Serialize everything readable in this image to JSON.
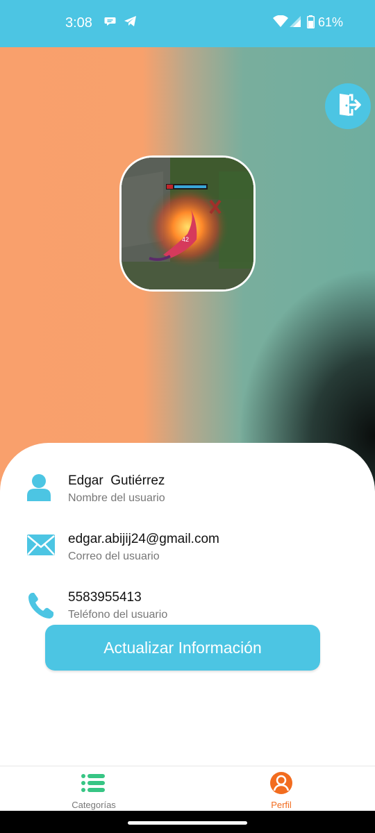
{
  "status_bar": {
    "time": "3:08",
    "battery_text": "61%",
    "icons": [
      "chat-icon",
      "telegram-icon",
      "wifi-icon",
      "signal-icon",
      "battery-icon"
    ]
  },
  "header": {
    "logout_icon": "logout-door-icon",
    "avatar": {
      "description_icon": "game-screenshot-avatar",
      "level_number": "42"
    }
  },
  "profile": {
    "name": {
      "value": "Edgar  Gutiérrez",
      "caption": "Nombre del usuario",
      "icon": "user-icon"
    },
    "email": {
      "value": "edgar.abijij24@gmail.com",
      "caption": "Correo del usuario",
      "icon": "mail-icon"
    },
    "phone": {
      "value": "5583955413",
      "caption": "Teléfono del usuario",
      "icon": "phone-icon"
    }
  },
  "actions": {
    "update_label": "Actualizar Información"
  },
  "bottom_nav": {
    "items": [
      {
        "label": "Categorías",
        "icon": "list-icon",
        "active": false
      },
      {
        "label": "Perfil",
        "icon": "profile-icon",
        "active": true
      }
    ]
  },
  "colors": {
    "accent": "#4cc5e3",
    "active_nav": "#f26c1f",
    "list_icon": "#37c584"
  }
}
